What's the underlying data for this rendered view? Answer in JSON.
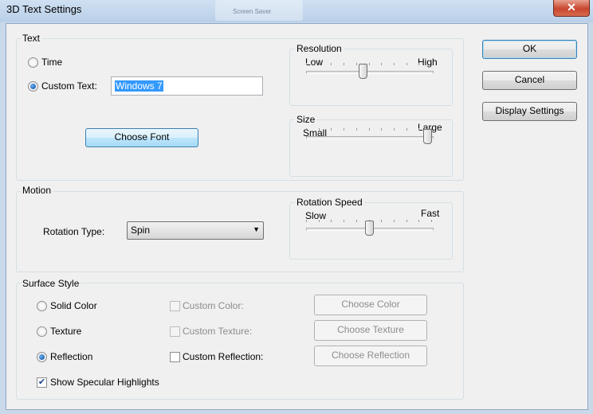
{
  "window": {
    "title": "3D Text Settings",
    "background_title": "Screen Saver",
    "close_label": "✕"
  },
  "text_group": {
    "label": "Text",
    "time_label": "Time",
    "custom_text_label": "Custom Text:",
    "custom_text_value": "Windows 7",
    "choose_font_label": "Choose Font",
    "selected_option": "custom_text"
  },
  "resolution": {
    "label": "Resolution",
    "low_label": "Low",
    "high_label": "High",
    "value_fraction": 0.45
  },
  "size": {
    "label": "Size",
    "small_label": "Small",
    "large_label": "Large",
    "value_fraction": 1.0
  },
  "motion_group": {
    "label": "Motion",
    "rotation_type_label": "Rotation Type:",
    "rotation_type_value": "Spin"
  },
  "rotation_speed": {
    "label": "Rotation Speed",
    "slow_label": "Slow",
    "fast_label": "Fast",
    "value_fraction": 0.5
  },
  "surface_group": {
    "label": "Surface Style",
    "solid_color_label": "Solid Color",
    "texture_label": "Texture",
    "reflection_label": "Reflection",
    "selected_option": "reflection",
    "custom_color_label": "Custom Color:",
    "custom_texture_label": "Custom Texture:",
    "custom_reflection_label": "Custom Reflection:",
    "choose_color_label": "Choose Color",
    "choose_texture_label": "Choose Texture",
    "choose_reflection_label": "Choose Reflection",
    "show_specular_label": "Show Specular Highlights",
    "show_specular_checked": true
  },
  "buttons": {
    "ok_label": "OK",
    "cancel_label": "Cancel",
    "display_settings_label": "Display Settings"
  }
}
